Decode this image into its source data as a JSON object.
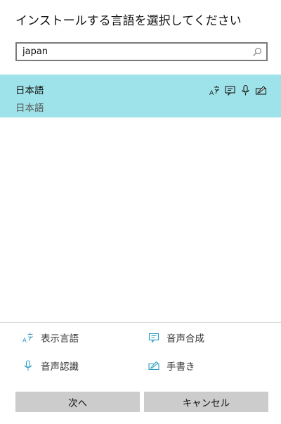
{
  "dialog": {
    "title": "インストールする言語を選択してください"
  },
  "search": {
    "value": "japan",
    "icon": "search-icon"
  },
  "results": [
    {
      "name": "日本語",
      "native_name": "日本語",
      "selected": true,
      "features": [
        "display-language-icon",
        "text-to-speech-icon",
        "speech-recognition-icon",
        "handwriting-icon"
      ]
    }
  ],
  "legend": {
    "display_language": "表示言語",
    "text_to_speech": "音声合成",
    "speech_recognition": "音声認識",
    "handwriting": "手書き"
  },
  "buttons": {
    "next": "次へ",
    "cancel": "キャンセル"
  },
  "colors": {
    "selected_row": "#9ee3e9",
    "accent_icon": "#2c9cc4",
    "button_bg": "#cccccc"
  }
}
